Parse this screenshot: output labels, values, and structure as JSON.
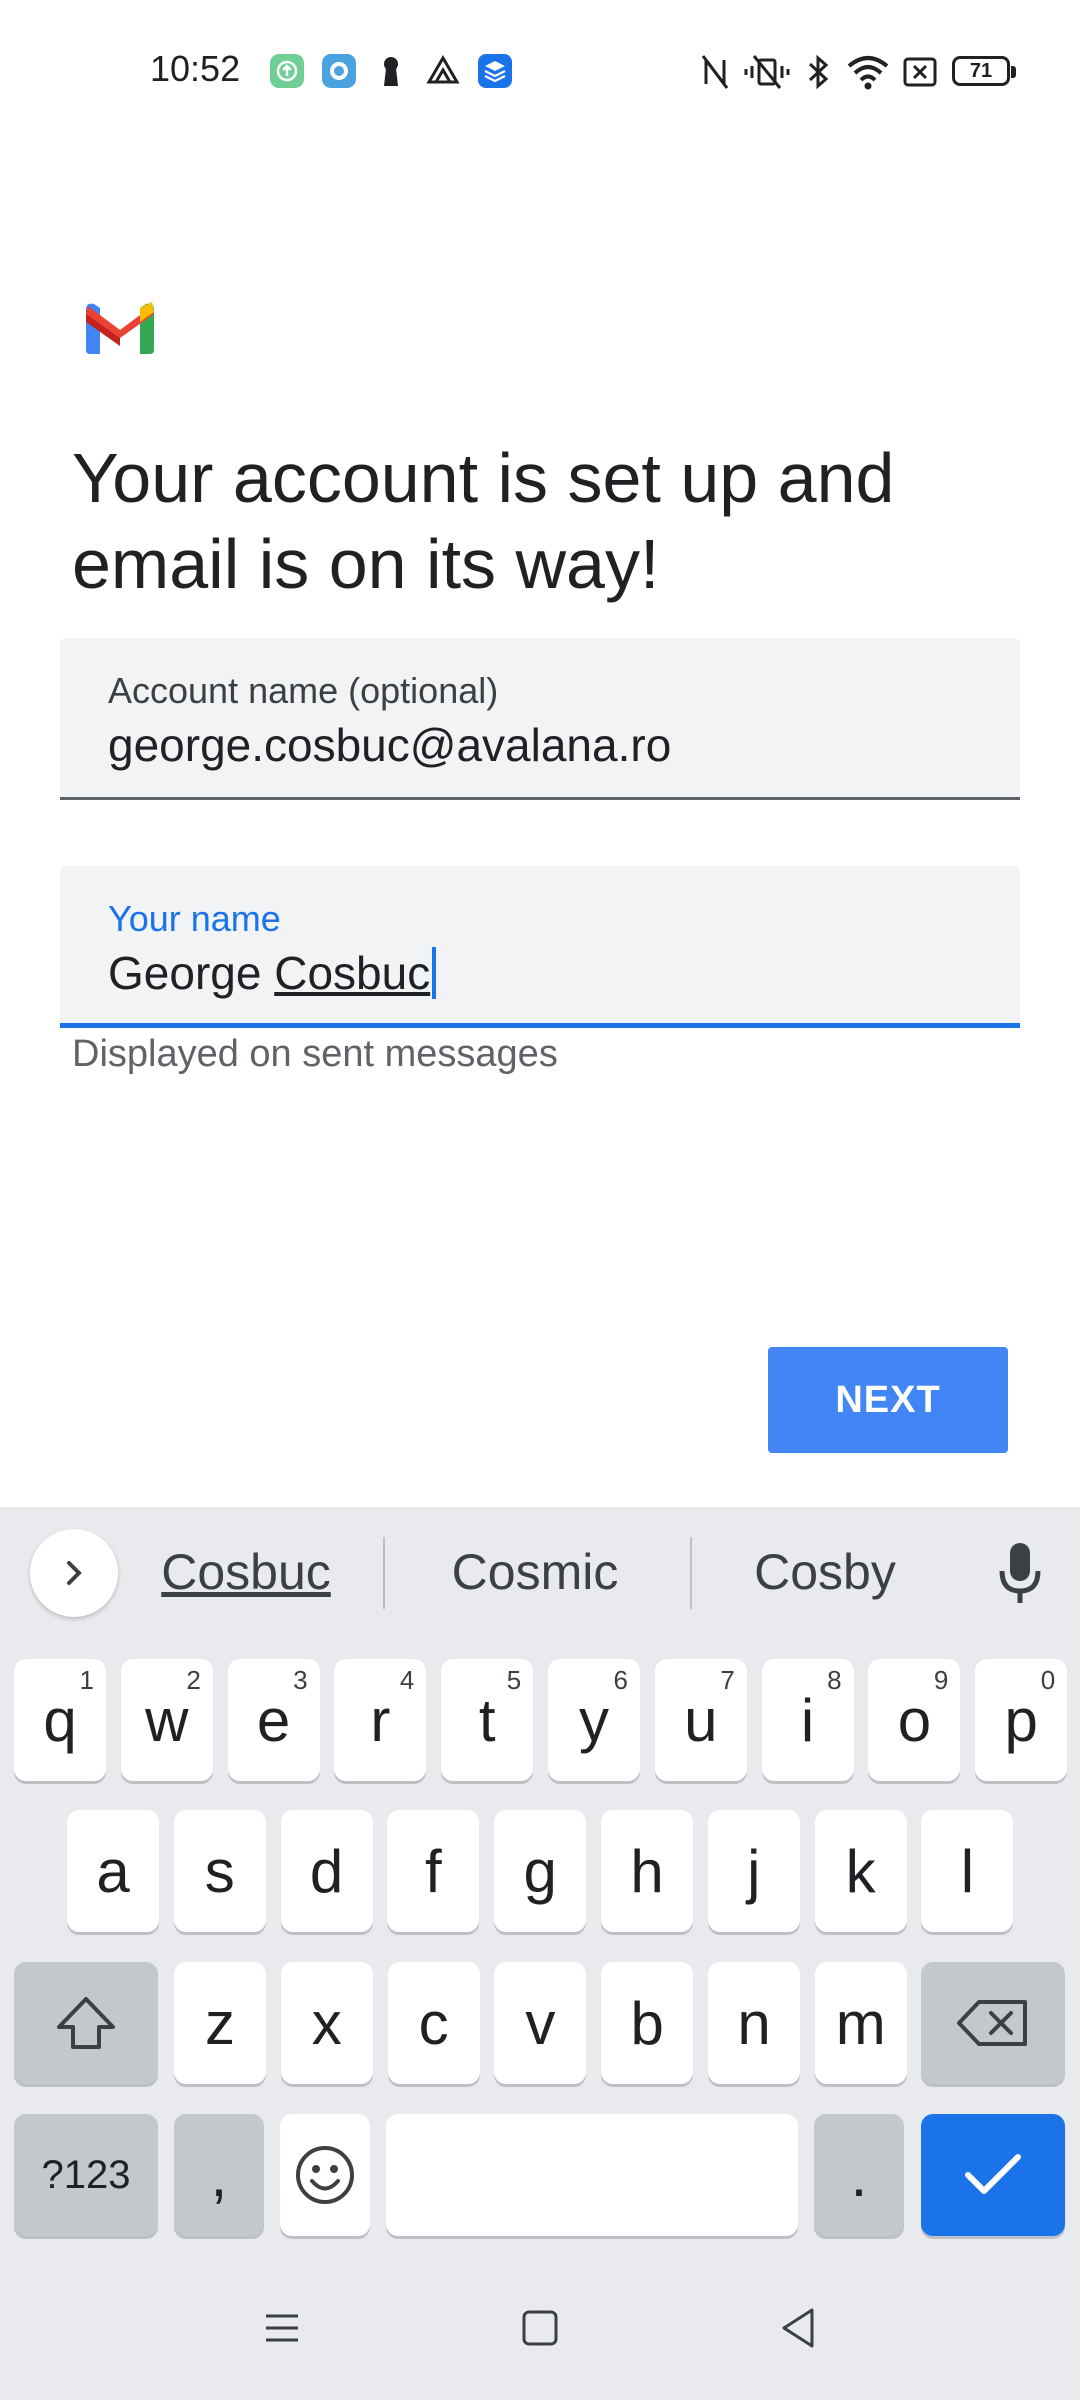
{
  "status_bar": {
    "time": "10:52",
    "battery": "71",
    "app_icons": [
      "upload-icon",
      "circle-app-icon",
      "keyhole-icon",
      "drive-icon",
      "layers-icon"
    ],
    "system_icons": [
      "nfc-icon",
      "vibrate-icon",
      "bluetooth-icon",
      "wifi-icon",
      "sim-icon",
      "battery-icon"
    ]
  },
  "header": {
    "logo": "gmail-logo",
    "title": "Your account is set up and email is on its way!"
  },
  "form": {
    "account_name": {
      "label": "Account name (optional)",
      "value": "george.cosbuc@avalana.ro"
    },
    "your_name": {
      "label": "Your name",
      "value_first": "George",
      "value_last": "Cosbuc",
      "helper": "Displayed on sent messages"
    }
  },
  "actions": {
    "next_label": "NEXT"
  },
  "keyboard": {
    "suggestions": [
      "Cosbuc",
      "Cosmic",
      "Cosby"
    ],
    "row1": [
      {
        "k": "q",
        "h": "1"
      },
      {
        "k": "w",
        "h": "2"
      },
      {
        "k": "e",
        "h": "3"
      },
      {
        "k": "r",
        "h": "4"
      },
      {
        "k": "t",
        "h": "5"
      },
      {
        "k": "y",
        "h": "6"
      },
      {
        "k": "u",
        "h": "7"
      },
      {
        "k": "i",
        "h": "8"
      },
      {
        "k": "o",
        "h": "9"
      },
      {
        "k": "p",
        "h": "0"
      }
    ],
    "row2": [
      "a",
      "s",
      "d",
      "f",
      "g",
      "h",
      "j",
      "k",
      "l"
    ],
    "row3": [
      "z",
      "x",
      "c",
      "v",
      "b",
      "n",
      "m"
    ],
    "symbols_label": "?123",
    "comma": ",",
    "period": "."
  },
  "colors": {
    "accent": "#1a73e8",
    "button": "#4285f4",
    "field_bg": "#f1f3f4",
    "keyboard_bg": "#e8eaed"
  }
}
